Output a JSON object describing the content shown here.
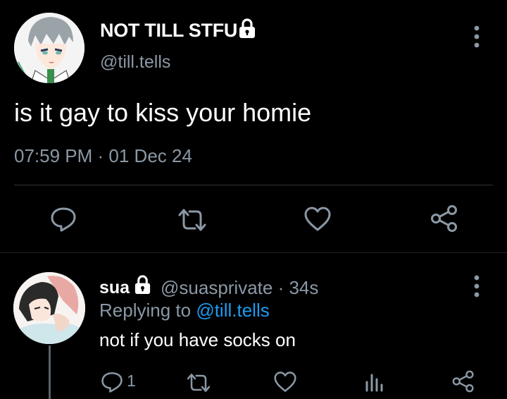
{
  "main_tweet": {
    "display_name": "NOT TILL STFU",
    "handle": "@till.tells",
    "text": "is it gay to kiss your homie",
    "timestamp": "07:59 PM · 01 Dec 24",
    "avatar": "avatar-icon",
    "verified_lock": "lock-icon",
    "actions": [
      "reply-icon",
      "retweet-icon",
      "like-icon",
      "share-icon"
    ]
  },
  "reply_tweet": {
    "display_name": "sua",
    "handle_time": "@suasprivate · 34s",
    "replying_prefix": "Replying to ",
    "replying_handle": "@till.tells",
    "text": "not if you have socks on",
    "reply_count": "1",
    "actions": [
      "reply-icon",
      "retweet-icon",
      "like-icon",
      "stats-icon",
      "share-icon"
    ]
  },
  "colors": {
    "background": "#000000",
    "primary_text": "#ffffff",
    "secondary_text": "#8b98a5",
    "link": "#1d9bf0",
    "divider": "#2f3336"
  }
}
